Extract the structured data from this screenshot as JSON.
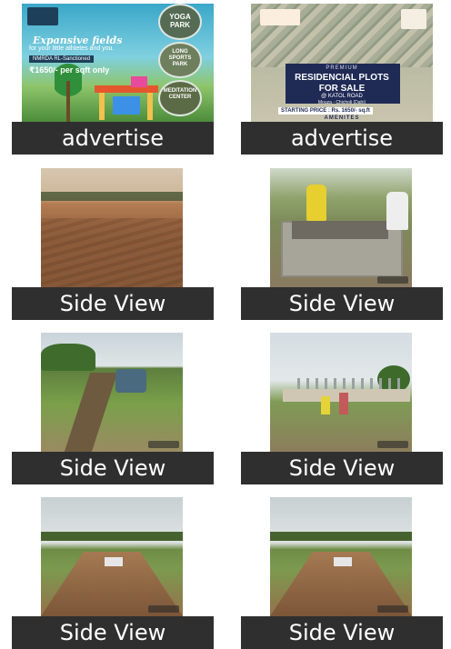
{
  "tiles": [
    {
      "caption": "advertise",
      "ad": {
        "headline": "Expansive fields",
        "subline": "for your little athletes and you.",
        "tag": "NMRDA RL-Sanctioned",
        "price": "₹1650/- per sqft only",
        "badges": [
          "YOGA PARK",
          "LONG SPORTS PARK",
          "MEDITATION CENTER"
        ]
      }
    },
    {
      "caption": "advertise",
      "ad": {
        "line1": "PREMIUM",
        "line2": "RESIDENCIAL PLOTS",
        "line3": "FOR SALE",
        "line4": "@ KATOL ROAD",
        "location": "Mouza - Chicholi (Dahi)",
        "price": "STARTING PRICE : Rs. 1650/- sq.ft",
        "amenities": "AMENITES"
      }
    },
    {
      "caption": "Side View"
    },
    {
      "caption": "Side View"
    },
    {
      "caption": "Side View"
    },
    {
      "caption": "Side View"
    },
    {
      "caption": "Side View"
    },
    {
      "caption": "Side View"
    }
  ]
}
